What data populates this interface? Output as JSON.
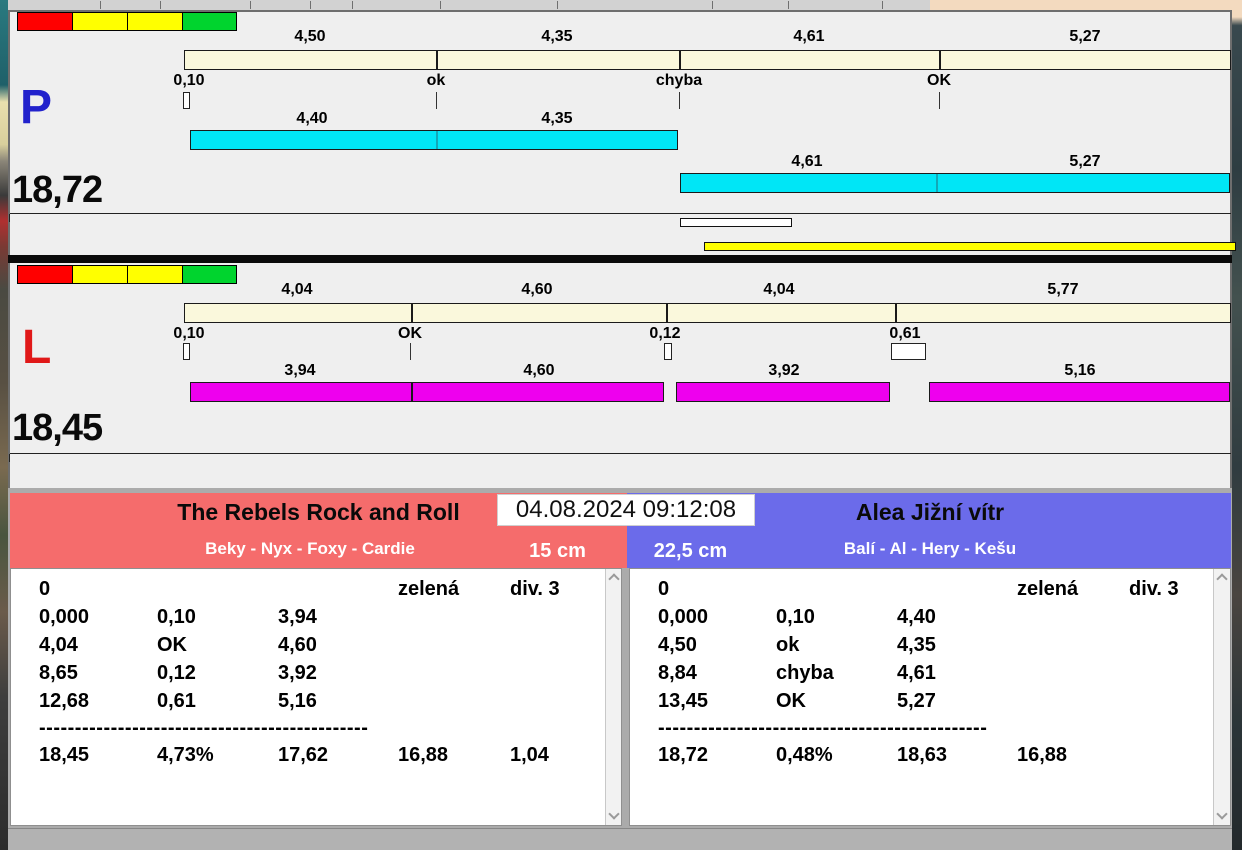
{
  "p": {
    "label": "P",
    "total": "18,72",
    "scale_labels": [
      "4,50",
      "4,35",
      "4,61",
      "5,27"
    ],
    "tick_labels": [
      "0,10",
      "ok",
      "chyba",
      "OK"
    ],
    "run1_labels": [
      "4,40",
      "4,35"
    ],
    "run2_labels": [
      "4,61",
      "5,27"
    ]
  },
  "l": {
    "label": "L",
    "total": "18,45",
    "scale_labels": [
      "4,04",
      "4,60",
      "4,04",
      "5,77"
    ],
    "tick_labels": [
      "0,10",
      "OK",
      "0,12",
      "0,61"
    ],
    "run_labels": [
      "3,94",
      "4,60",
      "3,92",
      "5,16"
    ]
  },
  "datetime": "04.08.2024 09:12:08",
  "team_left": {
    "title": "The Rebels Rock and Roll",
    "members": "Beky - Nyx - Foxy - Cardie",
    "jump_height": "15 cm",
    "status_row": {
      "start": "0",
      "light": "zelená",
      "division": "div. 3"
    },
    "splits": [
      [
        "0,000",
        "0,10",
        "3,94"
      ],
      [
        "4,04",
        "OK",
        "4,60"
      ],
      [
        "8,65",
        "0,12",
        "3,92"
      ],
      [
        "12,68",
        "0,61",
        "5,16"
      ]
    ],
    "separator": "----------------------------------------------",
    "totals": [
      "18,45",
      "4,73%",
      "17,62",
      "16,88",
      "1,04"
    ]
  },
  "team_right": {
    "title": "Alea Jižní vítr",
    "members": "Balí - Al - Hery - Kešu",
    "jump_height": "22,5 cm",
    "status_row": {
      "start": "0",
      "light": "zelená",
      "division": "div. 3"
    },
    "splits": [
      [
        "0,000",
        "0,10",
        "4,40"
      ],
      [
        "4,50",
        "ok",
        "4,35"
      ],
      [
        "8,84",
        "chyba",
        "4,61"
      ],
      [
        "13,45",
        "OK",
        "5,27"
      ]
    ],
    "separator": "----------------------------------------------",
    "totals": [
      "18,72",
      "0,48%",
      "18,63",
      "16,88"
    ]
  },
  "colors": {
    "p_letter": "#2222cc",
    "l_letter": "#e01818",
    "scale_bar": "#faf8dc",
    "p_run_bar": "#00e6f6",
    "l_run_bar": "#ee00ee",
    "yellow_bar": "#ffff00",
    "light_red": "#ff0000",
    "light_yellow": "#ffff00",
    "light_green": "#00d42e",
    "team_left_header": "#f56c6c",
    "team_right_header": "#6b6bea"
  }
}
